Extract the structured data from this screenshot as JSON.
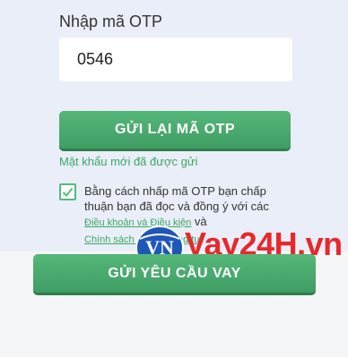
{
  "otp": {
    "label": "Nhập mã OTP",
    "value": "0546"
  },
  "resend_button": "GỬI LẠI MÃ OTP",
  "sent_message": "Mật khẩu mới đã được gửi",
  "consent": {
    "checked": true,
    "text_before": "Bằng cách nhấp mã OTP bạn chấp thuận bạn đã đọc và đồng ý với các ",
    "terms_link": "Điều khoản và Điều kiện",
    "text_middle": " và ",
    "privacy_link": "Chính sách quyền riêng tư"
  },
  "submit_button": "GỬI YÊU CẦU VAY",
  "watermark": {
    "logo_text": "VN",
    "brand_text": "Vay24H.vn"
  },
  "colors": {
    "accent_green": "#4fae73",
    "link_green": "#3ea765",
    "panel_bg": "#e9eef8",
    "watermark_red": "#e8282b",
    "watermark_blue": "#1e57b8"
  }
}
